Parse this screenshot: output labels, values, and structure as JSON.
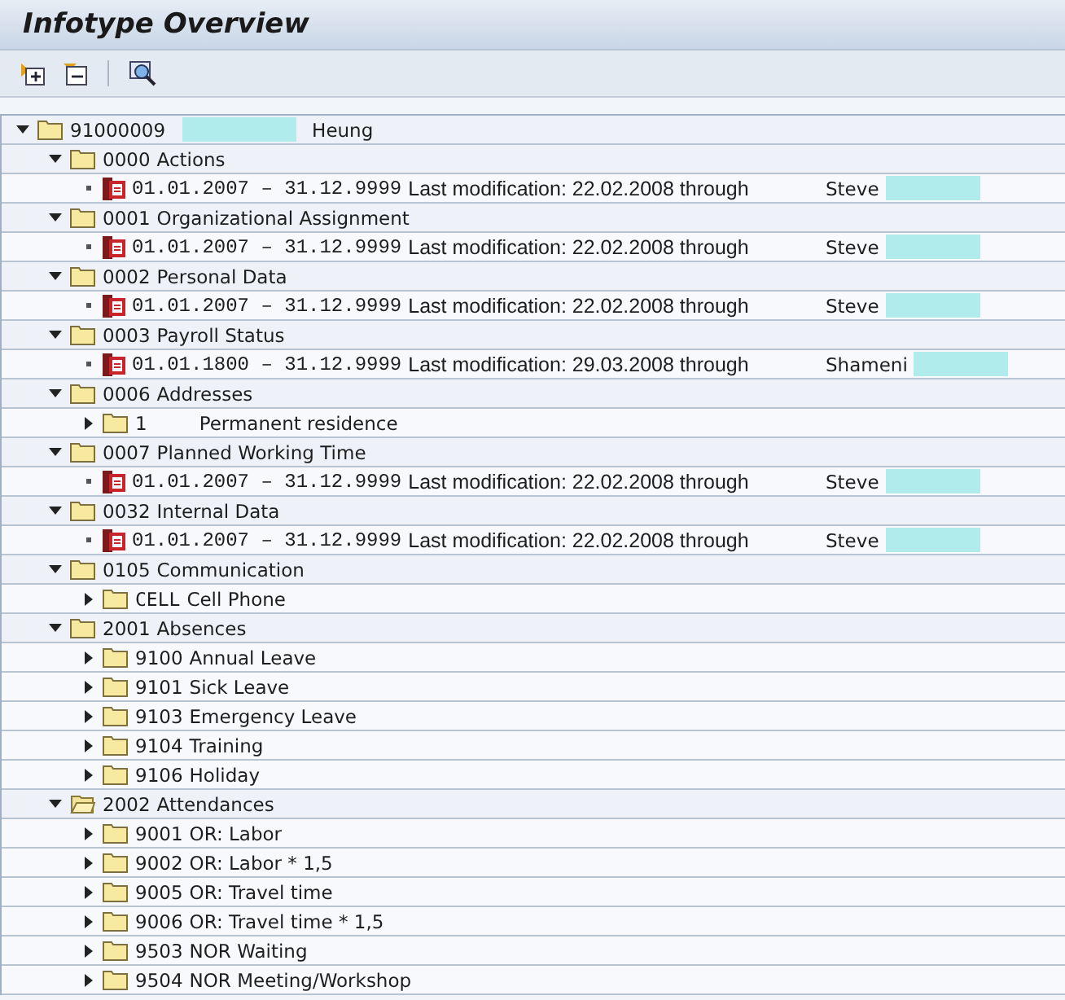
{
  "window": {
    "title": "Infotype Overview"
  },
  "toolbar": {
    "buttons": [
      {
        "kind": "expand"
      },
      {
        "kind": "collapse"
      },
      {
        "kind": "find"
      }
    ]
  },
  "tree": {
    "children": [
      {
        "kind": "folder",
        "expanded": true,
        "code": "91000009",
        "label": "Heung",
        "redacted": true,
        "children": [
          {
            "kind": "folder",
            "expanded": true,
            "code": "0000",
            "label": "Actions",
            "children": [
              {
                "kind": "record",
                "period": "01.01.2007 – 31.12.9999",
                "text": "Last modification: 22.02.2008 through",
                "user": "Steve",
                "redacted": true
              }
            ]
          },
          {
            "kind": "folder",
            "expanded": true,
            "code": "0001",
            "label": "Organizational Assignment",
            "children": [
              {
                "kind": "record",
                "period": "01.01.2007 – 31.12.9999",
                "text": "Last modification: 22.02.2008 through",
                "user": "Steve",
                "redacted": true
              }
            ]
          },
          {
            "kind": "folder",
            "expanded": true,
            "code": "0002",
            "label": "Personal Data",
            "children": [
              {
                "kind": "record",
                "period": "01.01.2007 – 31.12.9999",
                "text": "Last modification: 22.02.2008 through",
                "user": "Steve",
                "redacted": true
              }
            ]
          },
          {
            "kind": "folder",
            "expanded": true,
            "code": "0003",
            "label": "Payroll Status",
            "children": [
              {
                "kind": "record",
                "period": "01.01.1800 – 31.12.9999",
                "text": "Last modification: 29.03.2008 through",
                "user": "Shameni",
                "redacted": true
              }
            ]
          },
          {
            "kind": "folder",
            "expanded": true,
            "code": "0006",
            "label": "Addresses",
            "children": [
              {
                "kind": "folder",
                "expanded": false,
                "code": "1",
                "label": "Permanent residence"
              }
            ]
          },
          {
            "kind": "folder",
            "expanded": true,
            "code": "0007",
            "label": "Planned Working Time",
            "children": [
              {
                "kind": "record",
                "period": "01.01.2007 – 31.12.9999",
                "text": "Last modification: 22.02.2008 through",
                "user": "Steve",
                "redacted": true
              }
            ]
          },
          {
            "kind": "folder",
            "expanded": true,
            "code": "0032",
            "label": "Internal Data",
            "children": [
              {
                "kind": "record",
                "period": "01.01.2007 – 31.12.9999",
                "text": "Last modification: 22.02.2008 through",
                "user": "Steve",
                "redacted": true
              }
            ]
          },
          {
            "kind": "folder",
            "expanded": true,
            "code": "0105",
            "label": "Communication",
            "children": [
              {
                "kind": "folder",
                "expanded": false,
                "code": "CELL",
                "label": "Cell Phone"
              }
            ]
          },
          {
            "kind": "folder",
            "expanded": true,
            "code": "2001",
            "label": "Absences",
            "children": [
              {
                "kind": "folder",
                "expanded": false,
                "code": "9100",
                "label": "Annual Leave"
              },
              {
                "kind": "folder",
                "expanded": false,
                "code": "9101",
                "label": "Sick Leave"
              },
              {
                "kind": "folder",
                "expanded": false,
                "code": "9103",
                "label": "Emergency Leave"
              },
              {
                "kind": "folder",
                "expanded": false,
                "code": "9104",
                "label": "Training"
              },
              {
                "kind": "folder",
                "expanded": false,
                "code": "9106",
                "label": "Holiday"
              }
            ]
          },
          {
            "kind": "open-folder",
            "expanded": true,
            "code": "2002",
            "label": "Attendances",
            "children": [
              {
                "kind": "folder",
                "expanded": false,
                "code": "9001",
                "label": "OR: Labor"
              },
              {
                "kind": "folder",
                "expanded": false,
                "code": "9002",
                "label": "OR: Labor * 1,5"
              },
              {
                "kind": "folder",
                "expanded": false,
                "code": "9005",
                "label": "OR: Travel time"
              },
              {
                "kind": "folder",
                "expanded": false,
                "code": "9006",
                "label": "OR: Travel time * 1,5"
              },
              {
                "kind": "folder",
                "expanded": false,
                "code": "9503",
                "label": "NOR Waiting"
              },
              {
                "kind": "folder",
                "expanded": false,
                "code": "9504",
                "label": "NOR Meeting/Workshop"
              }
            ]
          }
        ]
      }
    ]
  }
}
